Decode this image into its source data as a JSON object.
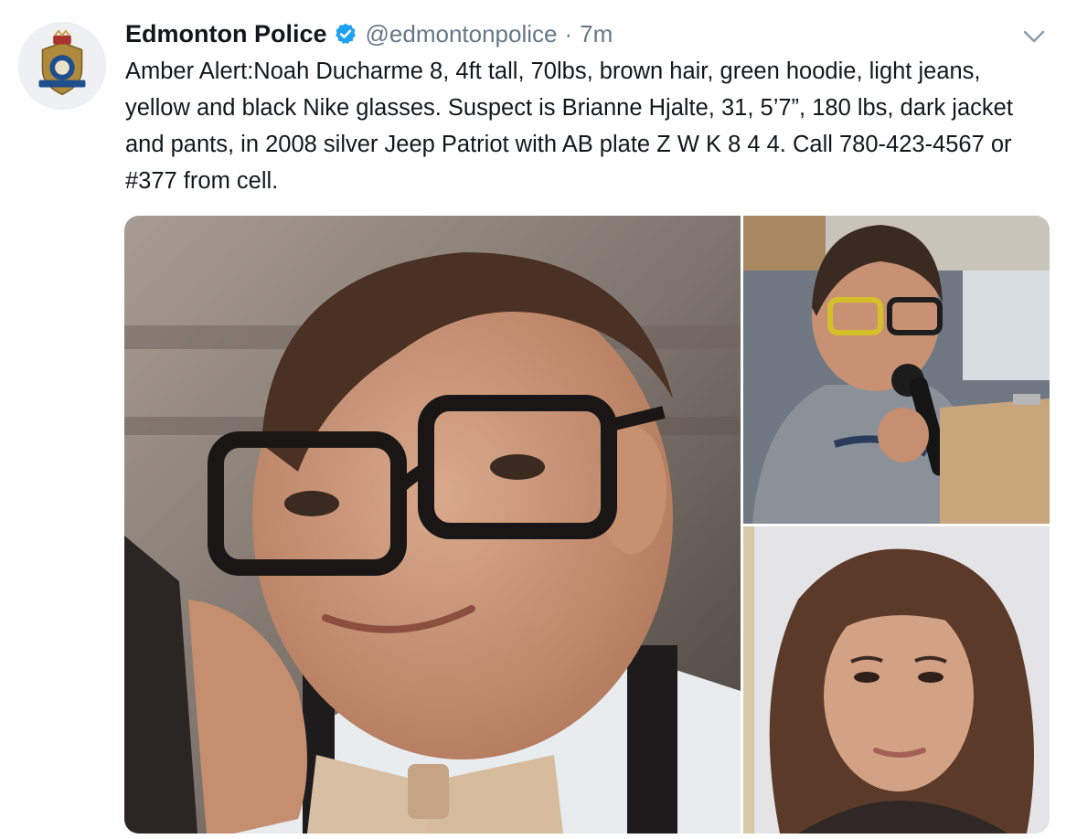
{
  "tweet": {
    "author_name": "Edmonton Police",
    "handle": "@edmontonpolice",
    "separator": "·",
    "time": "7m",
    "text": "Amber Alert:Noah Ducharme 8, 4ft tall, 70lbs, brown hair, green hoodie, light jeans, yellow and black Nike glasses. Suspect is Brianne Hjalte, 31, 5’7”, 180 lbs, dark jacket and pants, in 2008 silver Jeep Patriot with AB plate Z W K 8 4 4. Call 780-423-4567 or #377 from cell."
  },
  "icons": {
    "avatar": "police-crest-icon",
    "verified": "verified-badge-icon",
    "menu": "chevron-down-icon"
  },
  "colors": {
    "text": "#14171a",
    "secondary": "#657786",
    "verified": "#1da1f2"
  }
}
